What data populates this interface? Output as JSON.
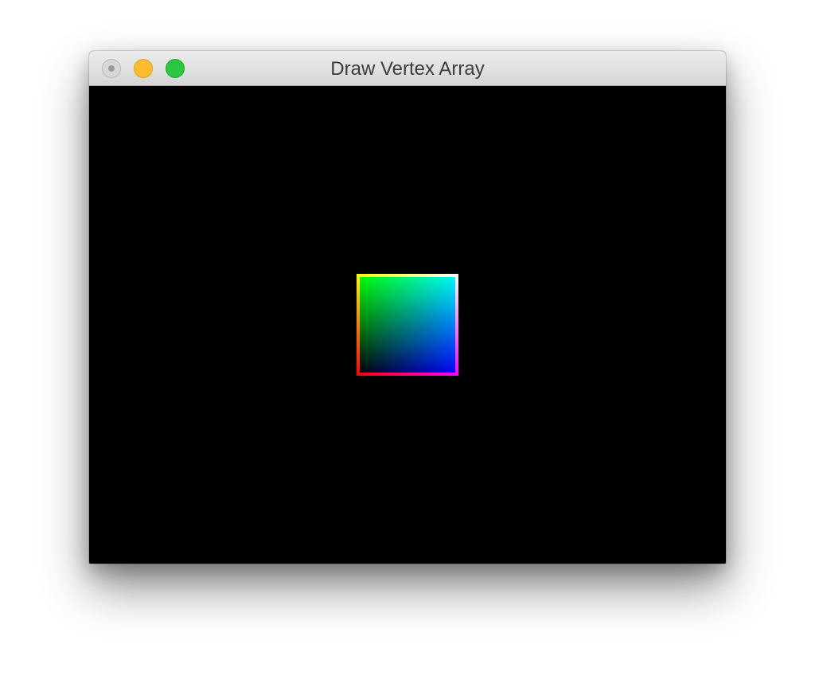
{
  "window": {
    "title": "Draw Vertex Array",
    "controls": {
      "close": {
        "icon": "close-icon",
        "color": "#d8d8d8"
      },
      "minimize": {
        "icon": "minimize-icon",
        "color": "#febc2e"
      },
      "maximize": {
        "icon": "maximize-icon",
        "color": "#29c840"
      }
    }
  },
  "canvas": {
    "background": "#000000",
    "quad": {
      "corner_colors": {
        "top_left": "#ffff00",
        "top_right": "#ffffff",
        "bottom_left": "#ff0000",
        "bottom_right": "#ff00ff",
        "inner_top_left": "#00ff00",
        "inner_top_right": "#00ffff",
        "inner_bottom_left": "#000000",
        "inner_bottom_right": "#0000ff"
      }
    }
  }
}
